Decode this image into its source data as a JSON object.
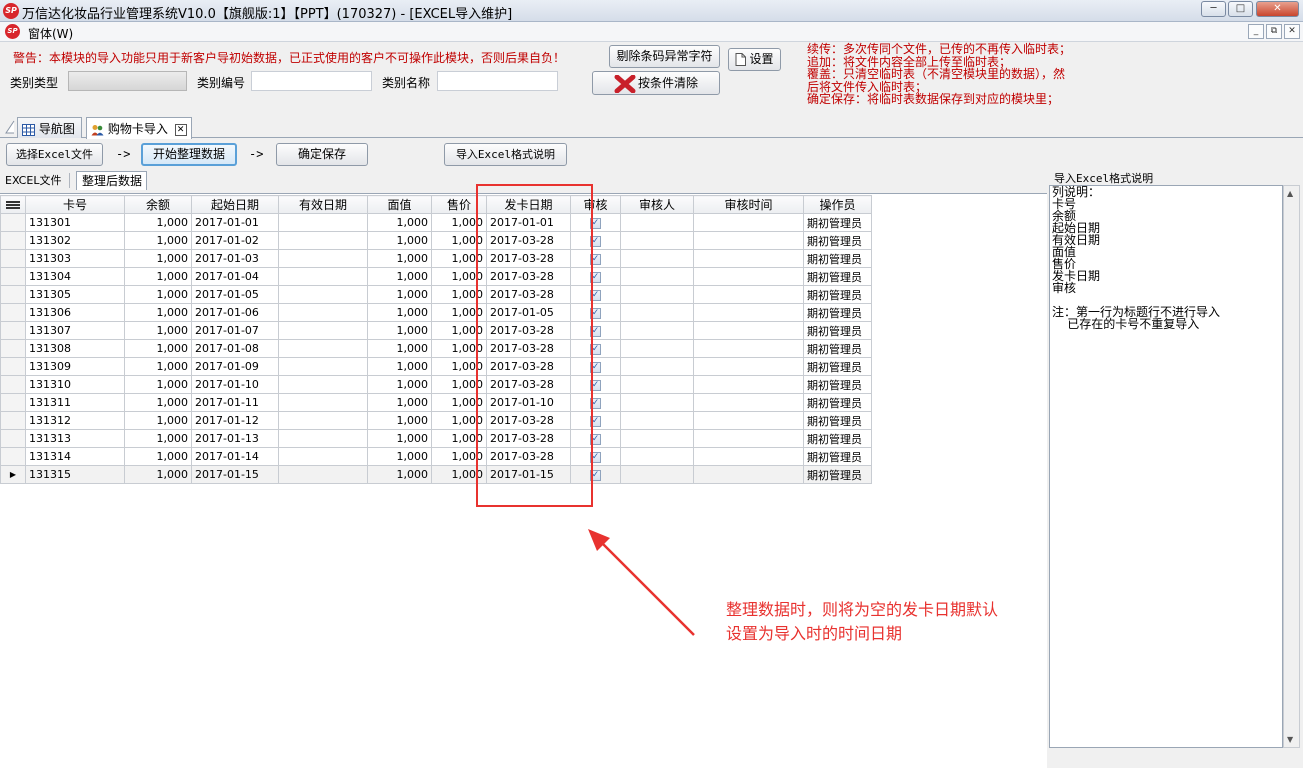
{
  "window": {
    "title": "万信达化妆品行业管理系统V10.0【旗舰版:1】【PPT】(170327) - [EXCEL导入维护]",
    "logo_text": "SP",
    "min_label": "─",
    "max_label": "□",
    "close_label": "✕"
  },
  "menubar": {
    "window_menu": "窗体(W)",
    "mdi_min": "_",
    "mdi_restore": "⧉",
    "mdi_close": "✕"
  },
  "toppanel": {
    "warning": "警告：本模块的导入功能只用于新客户导初始数据，已正式使用的客户不可操作此模块，否则后果自负！",
    "category_type_label": "类别类型",
    "category_code_label": "类别编号",
    "category_name_label": "类别名称",
    "category_type_value": "",
    "category_code_value": "",
    "category_name_value": "",
    "strip_barcode_button": "剔除条码异常字符",
    "settings_button": "设置",
    "clear_condition_button": "按条件清除",
    "notes": "续传：多次传同个文件，已传的不再传入临时表；\n追加：将文件内容全部上传至临时表；\n覆盖：只清空临时表（不清空模块里的数据），然\n后将文件传入临时表；\n确定保存：将临时表数据保存到对应的模块里；"
  },
  "tabs": [
    {
      "label": "导航图"
    },
    {
      "label": "购物卡导入"
    }
  ],
  "toolbar": {
    "select_excel": "选择Excel文件",
    "arrow1": "->",
    "start_tidy": "开始整理数据",
    "arrow2": "->",
    "confirm_save": "确定保存",
    "format_help": "导入Excel格式说明"
  },
  "subtabs": {
    "excel_file": "EXCEL文件",
    "tidied": "整理后数据"
  },
  "grid": {
    "columns": [
      "卡号",
      "余额",
      "起始日期",
      "有效日期",
      "面值",
      "售价",
      "发卡日期",
      "审核",
      "审核人",
      "审核时间",
      "操作员"
    ],
    "rows": [
      [
        "131301",
        "1,000",
        "2017-01-01",
        "",
        "1,000",
        "1,000",
        "2017-01-01",
        "✓",
        "",
        "",
        "期初管理员"
      ],
      [
        "131302",
        "1,000",
        "2017-01-02",
        "",
        "1,000",
        "1,000",
        "2017-03-28",
        "✓",
        "",
        "",
        "期初管理员"
      ],
      [
        "131303",
        "1,000",
        "2017-01-03",
        "",
        "1,000",
        "1,000",
        "2017-03-28",
        "✓",
        "",
        "",
        "期初管理员"
      ],
      [
        "131304",
        "1,000",
        "2017-01-04",
        "",
        "1,000",
        "1,000",
        "2017-03-28",
        "✓",
        "",
        "",
        "期初管理员"
      ],
      [
        "131305",
        "1,000",
        "2017-01-05",
        "",
        "1,000",
        "1,000",
        "2017-03-28",
        "✓",
        "",
        "",
        "期初管理员"
      ],
      [
        "131306",
        "1,000",
        "2017-01-06",
        "",
        "1,000",
        "1,000",
        "2017-01-05",
        "✓",
        "",
        "",
        "期初管理员"
      ],
      [
        "131307",
        "1,000",
        "2017-01-07",
        "",
        "1,000",
        "1,000",
        "2017-03-28",
        "✓",
        "",
        "",
        "期初管理员"
      ],
      [
        "131308",
        "1,000",
        "2017-01-08",
        "",
        "1,000",
        "1,000",
        "2017-03-28",
        "✓",
        "",
        "",
        "期初管理员"
      ],
      [
        "131309",
        "1,000",
        "2017-01-09",
        "",
        "1,000",
        "1,000",
        "2017-03-28",
        "✓",
        "",
        "",
        "期初管理员"
      ],
      [
        "131310",
        "1,000",
        "2017-01-10",
        "",
        "1,000",
        "1,000",
        "2017-03-28",
        "✓",
        "",
        "",
        "期初管理员"
      ],
      [
        "131311",
        "1,000",
        "2017-01-11",
        "",
        "1,000",
        "1,000",
        "2017-01-10",
        "✓",
        "",
        "",
        "期初管理员"
      ],
      [
        "131312",
        "1,000",
        "2017-01-12",
        "",
        "1,000",
        "1,000",
        "2017-03-28",
        "✓",
        "",
        "",
        "期初管理员"
      ],
      [
        "131313",
        "1,000",
        "2017-01-13",
        "",
        "1,000",
        "1,000",
        "2017-03-28",
        "✓",
        "",
        "",
        "期初管理员"
      ],
      [
        "131314",
        "1,000",
        "2017-01-14",
        "",
        "1,000",
        "1,000",
        "2017-03-28",
        "✓",
        "",
        "",
        "期初管理员"
      ],
      [
        "131315",
        "1,000",
        "2017-01-15",
        "",
        "1,000",
        "1,000",
        "2017-01-15",
        "✓",
        "",
        "",
        "期初管理员"
      ]
    ],
    "current_row_marker": "▶"
  },
  "right_panel": {
    "title": "导入Excel格式说明",
    "text": "列说明：\n卡号\n余额\n起始日期\n有效日期\n面值\n售价\n发卡日期\n审核\n\n注：第一行为标题行不进行导入\n    已存在的卡号不重复导入"
  },
  "annotation": {
    "text_line1": "整理数据时，则将为空的发卡日期默认",
    "text_line2": "设置为导入时的时间日期",
    "color": "#e8322f"
  }
}
